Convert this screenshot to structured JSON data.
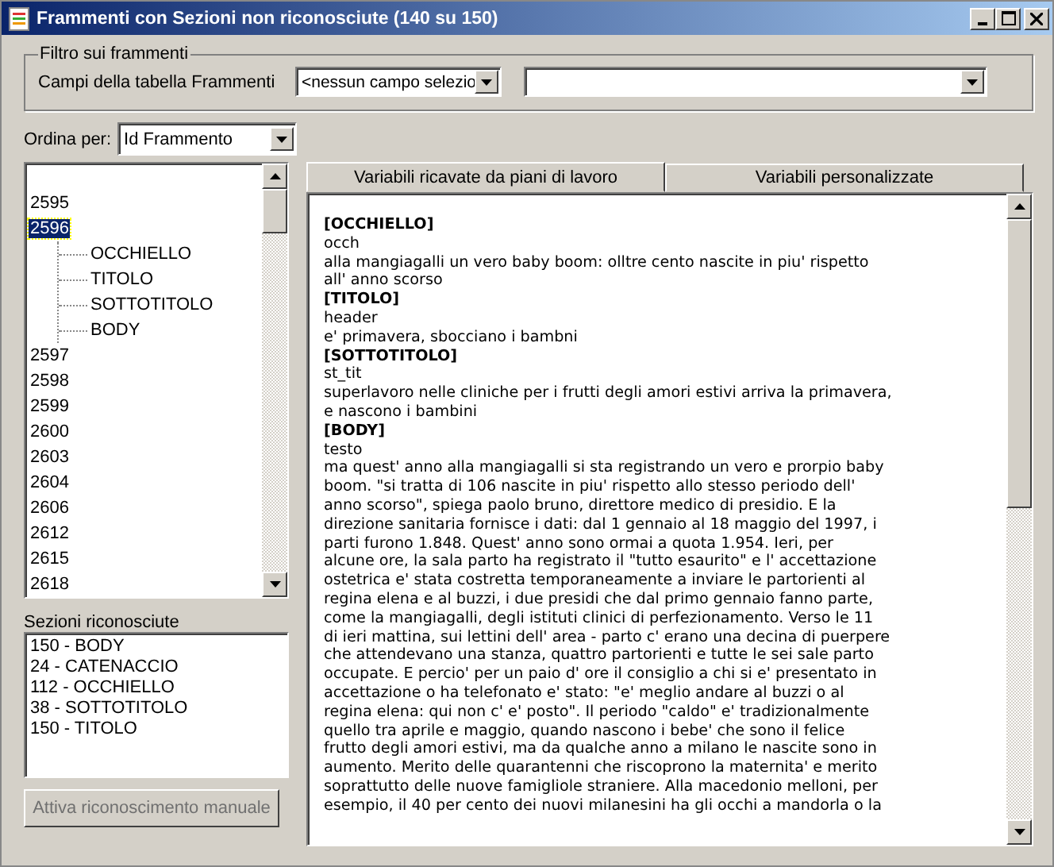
{
  "window": {
    "title": "Frammenti con Sezioni non riconosciute (140 su 150)"
  },
  "filter": {
    "title": "Filtro sui frammenti",
    "field_label": "Campi della tabella Frammenti",
    "field_combo": "<nessun campo selezio"
  },
  "sort": {
    "label": "Ordina per:",
    "value": "Id Frammento"
  },
  "tree": [
    {
      "label": "2595",
      "selected": false
    },
    {
      "label": "2596",
      "selected": true,
      "expanded": true,
      "children": [
        {
          "label": "OCCHIELLO"
        },
        {
          "label": "TITOLO"
        },
        {
          "label": "SOTTOTITOLO"
        },
        {
          "label": "BODY"
        }
      ]
    },
    {
      "label": "2597",
      "selected": false
    },
    {
      "label": "2598",
      "selected": false
    },
    {
      "label": "2599",
      "selected": false
    },
    {
      "label": "2600",
      "selected": false
    },
    {
      "label": "2603",
      "selected": false
    },
    {
      "label": "2604",
      "selected": false
    },
    {
      "label": "2606",
      "selected": false
    },
    {
      "label": "2612",
      "selected": false
    },
    {
      "label": "2615",
      "selected": false
    },
    {
      "label": "2618",
      "selected": false
    }
  ],
  "recognized": {
    "label": "Sezioni riconosciute",
    "items": [
      "150 - BODY",
      "24 - CATENACCIO",
      "112 - OCCHIELLO",
      "38 - SOTTOTITOLO",
      "150 - TITOLO"
    ]
  },
  "manual_button": {
    "label": "Attiva riconoscimento manuale",
    "disabled": true
  },
  "tabs": [
    {
      "label": "Variabili ricavate da piani di lavoro",
      "selected": true
    },
    {
      "label": "Variabili personalizzate",
      "selected": false
    }
  ],
  "sections": [
    {
      "heading": "[OCCHIELLO]",
      "lines": [
        "occh",
        "alla mangiagalli un vero baby boom: olltre cento nascite in piu' rispetto",
        "all' anno scorso"
      ]
    },
    {
      "heading": "[TITOLO]",
      "lines": [
        "header",
        "e' primavera, sbocciano i bambni"
      ]
    },
    {
      "heading": "[SOTTOTITOLO]",
      "lines": [
        "st_tit",
        "superlavoro nelle cliniche per i frutti degli amori estivi arriva la primavera,",
        "e nascono i bambini"
      ]
    },
    {
      "heading": "[BODY]",
      "lines": [
        "testo",
        "ma quest' anno alla mangiagalli si sta registrando un vero e prorpio baby",
        "boom. \"si tratta di 106 nascite in piu' rispetto allo stesso periodo dell'",
        "anno scorso\", spiega paolo bruno, direttore medico di presidio. E la",
        "direzione sanitaria fornisce i dati: dal 1 gennaio al 18 maggio del 1997, i",
        "parti furono 1.848. Quest' anno sono ormai a quota 1.954. Ieri, per",
        "alcune ore, la sala parto ha registrato il \"tutto esaurito\" e l' accettazione",
        "ostetrica e' stata costretta temporaneamente a inviare le partorienti al",
        "regina elena e al buzzi, i due presidi che dal primo gennaio fanno parte,",
        "come la mangiagalli, degli istituti clinici di perfezionamento. Verso le 11",
        "di ieri mattina, sui lettini dell' area - parto c' erano una decina di puerpere",
        "che attendevano una stanza, quattro partorienti e tutte le sei sale parto",
        "occupate. E percio' per un paio d' ore il consiglio a chi si e' presentato in",
        "accettazione o ha telefonato e' stato: \"e' meglio andare al buzzi o al",
        "regina elena: qui non c' e' posto\". Il periodo \"caldo\" e' tradizionalmente",
        "quello tra aprile e maggio, quando nascono i bebe' che sono il felice",
        "frutto degli amori estivi, ma da qualche anno a milano le nascite sono in",
        "aumento. Merito delle quarantenni che riscoprono la maternita' e merito",
        "soprattutto delle nuove famigliole straniere. Alla macedonio melloni, per",
        "esempio, il 40 per cento dei nuovi milanesini ha gli occhi a mandorla o la"
      ]
    }
  ]
}
